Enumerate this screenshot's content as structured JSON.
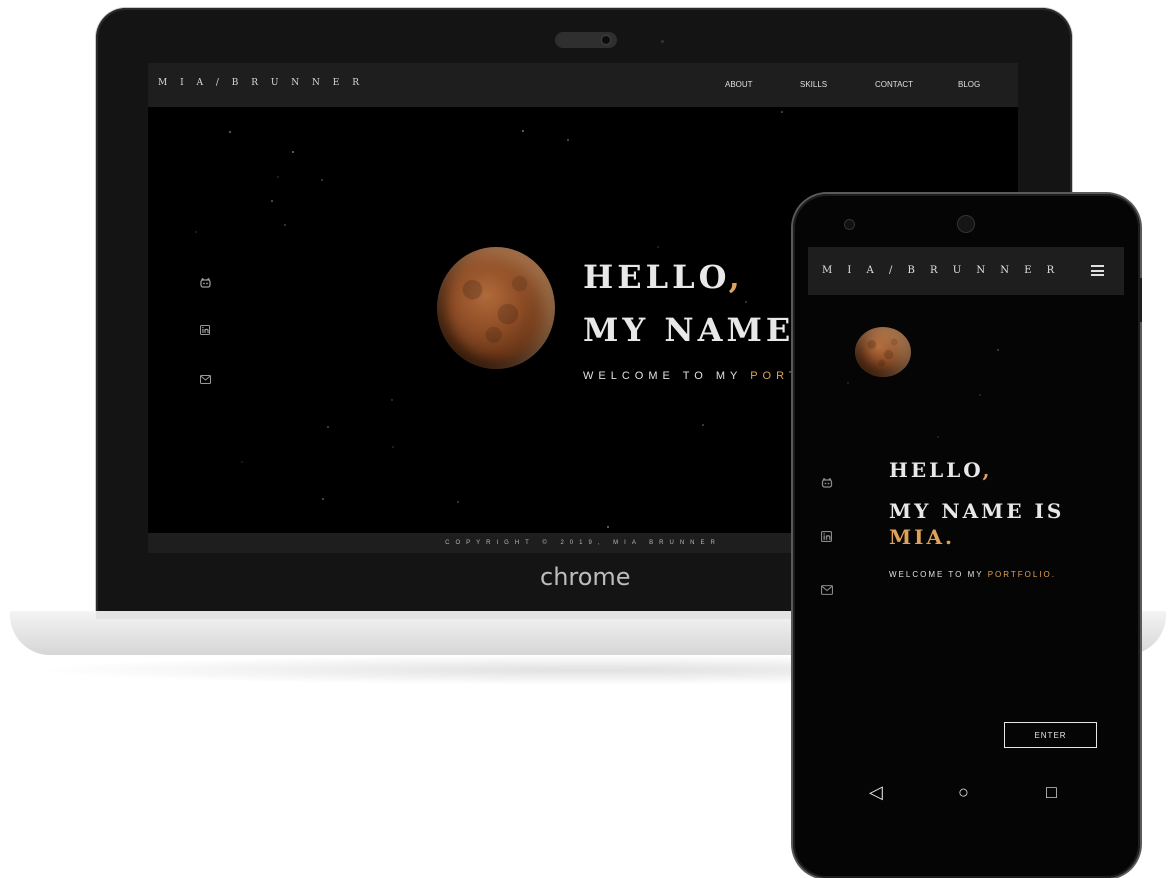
{
  "desktop": {
    "logo": "M I A / B R U N N E R",
    "menu": [
      {
        "label": "ABOUT"
      },
      {
        "label": "SKILLS"
      },
      {
        "label": "CONTACT"
      },
      {
        "label": "BLOG"
      }
    ],
    "hero": {
      "hello": "HELLO",
      "comma": ",",
      "name_line": "MY NAME I",
      "welcome_prefix": "WELCOME TO MY ",
      "welcome_accent": "PORT"
    },
    "social": {
      "github": "github-icon",
      "linkedin": "linkedin-icon",
      "email": "email-icon"
    },
    "footer": "COPYRIGHT © 2019, MIA BRUNNER",
    "browser_brand": "chrome"
  },
  "mobile": {
    "logo": "M I A / B R U N N E R",
    "menu_icon": "hamburger-menu-icon",
    "hero": {
      "hello": "HELLO",
      "comma": ",",
      "name_line1": "MY NAME IS",
      "name_line2": "MIA.",
      "welcome_prefix": "WELCOME TO MY ",
      "welcome_accent": "PORTFOLIO."
    },
    "enter_label": "ENTER",
    "nav_buttons": {
      "back": "◁",
      "home": "○",
      "recents": "□"
    }
  },
  "colors": {
    "accent": "#e0a25a",
    "nav_bg": "#1e1e1e",
    "background": "#000000"
  }
}
